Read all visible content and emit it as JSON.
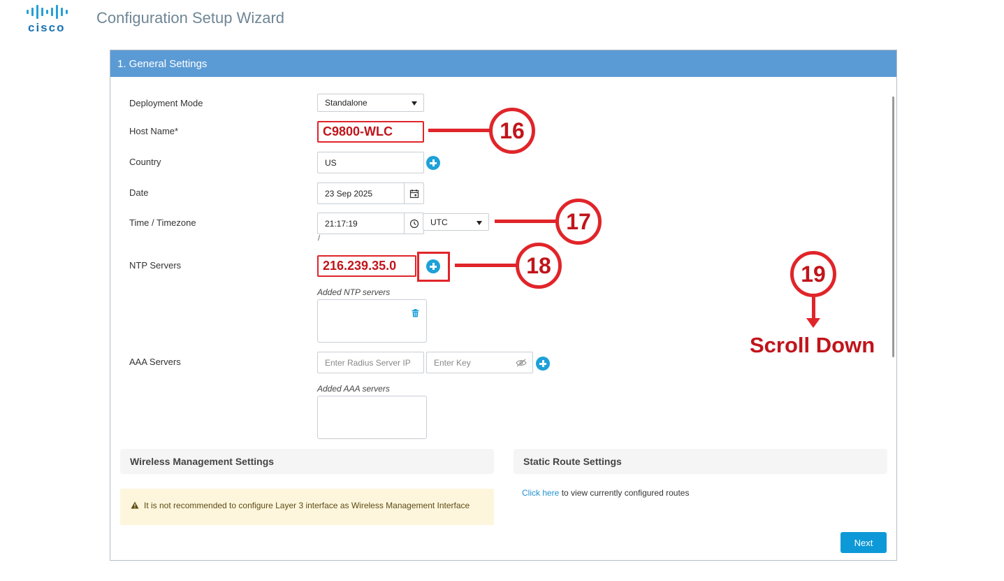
{
  "brand": {
    "logo_text": "cisco",
    "accent": "#1c73b5"
  },
  "app": {
    "title": "Configuration Setup Wizard"
  },
  "panel": {
    "header": "1. General Settings",
    "header_color": "#5b9bd5"
  },
  "form": {
    "deployment_mode": {
      "label": "Deployment Mode",
      "value": "Standalone"
    },
    "host_name": {
      "label": "Host Name*",
      "value": "C9800-WLC"
    },
    "country": {
      "label": "Country",
      "value": "US"
    },
    "date": {
      "label": "Date",
      "value": "23 Sep 2025"
    },
    "time": {
      "label": "Time / Timezone",
      "value": "21:17:19",
      "timezone": "UTC",
      "separator": "/"
    },
    "ntp": {
      "label": "NTP Servers",
      "value": "216.239.35.0",
      "added_label": "Added NTP servers"
    },
    "aaa": {
      "label": "AAA Servers",
      "ip_placeholder": "Enter Radius Server IP",
      "key_placeholder": "Enter Key",
      "added_label": "Added AAA servers"
    }
  },
  "wireless_mgmt": {
    "title": "Wireless Management Settings",
    "warning": "It is not recommended to configure Layer 3 interface as Wireless Management Interface"
  },
  "static_route": {
    "title": "Static Route Settings",
    "link_text": "Click here",
    "link_rest": " to view currently configured routes"
  },
  "footer": {
    "next_label": "Next"
  },
  "annotations": {
    "step16": "16",
    "step17": "17",
    "step18": "18",
    "step19": "19",
    "scroll_text": "Scroll Down",
    "color": "#e0252a"
  }
}
